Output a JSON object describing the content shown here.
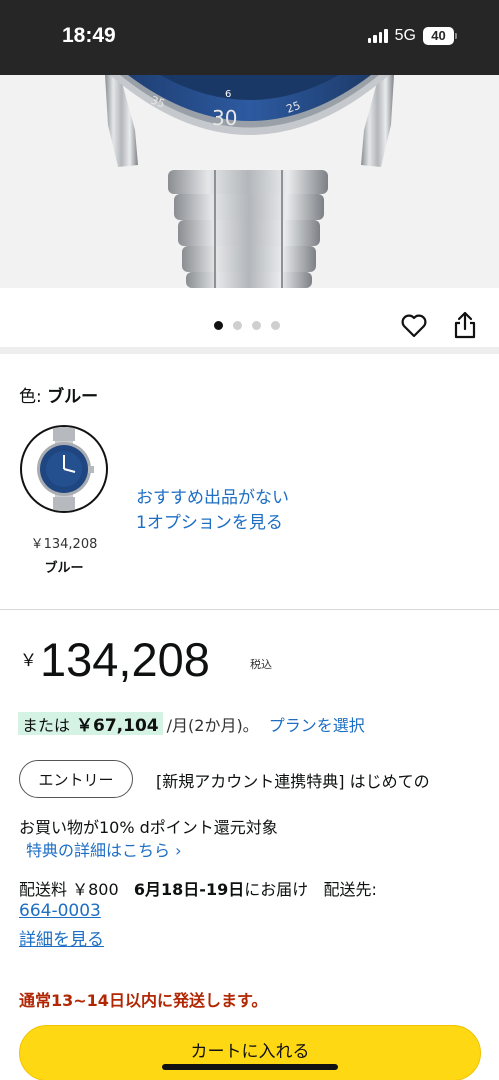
{
  "status_bar": {
    "time": "18:49",
    "network": "5G",
    "battery": "40"
  },
  "image_carousel": {
    "dot_count": 4,
    "active_index": 0
  },
  "color": {
    "label": "色: ",
    "value": "ブルー"
  },
  "swatch": {
    "price": "￥134,208",
    "name": "ブルー"
  },
  "no_offer_link": {
    "line1": "おすすめ出品がない",
    "line2": "1オプションを見る"
  },
  "price": {
    "symbol": "￥",
    "amount": "134,208",
    "tax": "税込"
  },
  "installment": {
    "prefix": "または",
    "amount": "￥67,104",
    "suffix": "/月(2か月)。",
    "plan_link": "プランを選択"
  },
  "promo": {
    "entry_button": "エントリー",
    "line1": "[新規アカウント連携特典] はじめての",
    "line2": "お買い物が10% dポイント還元対象",
    "benefit_link": "特典の詳細はこちら ›"
  },
  "delivery": {
    "fee_text": "配送料 ￥800",
    "date": "6月18日-19日",
    "date_suffix": "にお届け",
    "dest_label": "配送先:",
    "postal_code": "664-0003",
    "details_link": "詳細を見る"
  },
  "ship_notice": "通常13~14日以内に発送します。",
  "cart_button": "カートに入れる",
  "colors": {
    "link": "#1e6fc4",
    "cart": "#ffd814",
    "notice": "#b12704",
    "highlight": "#d4f3e5"
  }
}
